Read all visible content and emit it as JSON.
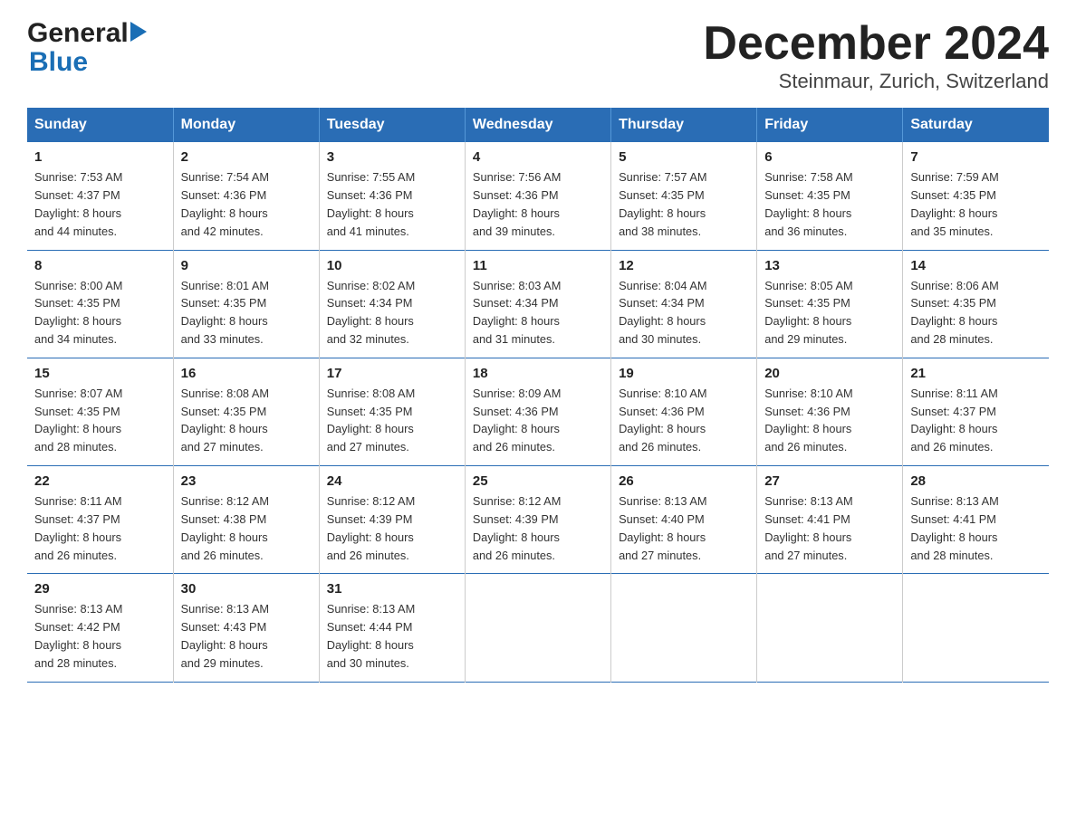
{
  "logo": {
    "general": "General",
    "blue": "Blue",
    "arrow": "▶"
  },
  "title": "December 2024",
  "subtitle": "Steinmaur, Zurich, Switzerland",
  "days_header": [
    "Sunday",
    "Monday",
    "Tuesday",
    "Wednesday",
    "Thursday",
    "Friday",
    "Saturday"
  ],
  "weeks": [
    [
      {
        "num": "1",
        "sunrise": "7:53 AM",
        "sunset": "4:37 PM",
        "daylight": "8 hours and 44 minutes."
      },
      {
        "num": "2",
        "sunrise": "7:54 AM",
        "sunset": "4:36 PM",
        "daylight": "8 hours and 42 minutes."
      },
      {
        "num": "3",
        "sunrise": "7:55 AM",
        "sunset": "4:36 PM",
        "daylight": "8 hours and 41 minutes."
      },
      {
        "num": "4",
        "sunrise": "7:56 AM",
        "sunset": "4:36 PM",
        "daylight": "8 hours and 39 minutes."
      },
      {
        "num": "5",
        "sunrise": "7:57 AM",
        "sunset": "4:35 PM",
        "daylight": "8 hours and 38 minutes."
      },
      {
        "num": "6",
        "sunrise": "7:58 AM",
        "sunset": "4:35 PM",
        "daylight": "8 hours and 36 minutes."
      },
      {
        "num": "7",
        "sunrise": "7:59 AM",
        "sunset": "4:35 PM",
        "daylight": "8 hours and 35 minutes."
      }
    ],
    [
      {
        "num": "8",
        "sunrise": "8:00 AM",
        "sunset": "4:35 PM",
        "daylight": "8 hours and 34 minutes."
      },
      {
        "num": "9",
        "sunrise": "8:01 AM",
        "sunset": "4:35 PM",
        "daylight": "8 hours and 33 minutes."
      },
      {
        "num": "10",
        "sunrise": "8:02 AM",
        "sunset": "4:34 PM",
        "daylight": "8 hours and 32 minutes."
      },
      {
        "num": "11",
        "sunrise": "8:03 AM",
        "sunset": "4:34 PM",
        "daylight": "8 hours and 31 minutes."
      },
      {
        "num": "12",
        "sunrise": "8:04 AM",
        "sunset": "4:34 PM",
        "daylight": "8 hours and 30 minutes."
      },
      {
        "num": "13",
        "sunrise": "8:05 AM",
        "sunset": "4:35 PM",
        "daylight": "8 hours and 29 minutes."
      },
      {
        "num": "14",
        "sunrise": "8:06 AM",
        "sunset": "4:35 PM",
        "daylight": "8 hours and 28 minutes."
      }
    ],
    [
      {
        "num": "15",
        "sunrise": "8:07 AM",
        "sunset": "4:35 PM",
        "daylight": "8 hours and 28 minutes."
      },
      {
        "num": "16",
        "sunrise": "8:08 AM",
        "sunset": "4:35 PM",
        "daylight": "8 hours and 27 minutes."
      },
      {
        "num": "17",
        "sunrise": "8:08 AM",
        "sunset": "4:35 PM",
        "daylight": "8 hours and 27 minutes."
      },
      {
        "num": "18",
        "sunrise": "8:09 AM",
        "sunset": "4:36 PM",
        "daylight": "8 hours and 26 minutes."
      },
      {
        "num": "19",
        "sunrise": "8:10 AM",
        "sunset": "4:36 PM",
        "daylight": "8 hours and 26 minutes."
      },
      {
        "num": "20",
        "sunrise": "8:10 AM",
        "sunset": "4:36 PM",
        "daylight": "8 hours and 26 minutes."
      },
      {
        "num": "21",
        "sunrise": "8:11 AM",
        "sunset": "4:37 PM",
        "daylight": "8 hours and 26 minutes."
      }
    ],
    [
      {
        "num": "22",
        "sunrise": "8:11 AM",
        "sunset": "4:37 PM",
        "daylight": "8 hours and 26 minutes."
      },
      {
        "num": "23",
        "sunrise": "8:12 AM",
        "sunset": "4:38 PM",
        "daylight": "8 hours and 26 minutes."
      },
      {
        "num": "24",
        "sunrise": "8:12 AM",
        "sunset": "4:39 PM",
        "daylight": "8 hours and 26 minutes."
      },
      {
        "num": "25",
        "sunrise": "8:12 AM",
        "sunset": "4:39 PM",
        "daylight": "8 hours and 26 minutes."
      },
      {
        "num": "26",
        "sunrise": "8:13 AM",
        "sunset": "4:40 PM",
        "daylight": "8 hours and 27 minutes."
      },
      {
        "num": "27",
        "sunrise": "8:13 AM",
        "sunset": "4:41 PM",
        "daylight": "8 hours and 27 minutes."
      },
      {
        "num": "28",
        "sunrise": "8:13 AM",
        "sunset": "4:41 PM",
        "daylight": "8 hours and 28 minutes."
      }
    ],
    [
      {
        "num": "29",
        "sunrise": "8:13 AM",
        "sunset": "4:42 PM",
        "daylight": "8 hours and 28 minutes."
      },
      {
        "num": "30",
        "sunrise": "8:13 AM",
        "sunset": "4:43 PM",
        "daylight": "8 hours and 29 minutes."
      },
      {
        "num": "31",
        "sunrise": "8:13 AM",
        "sunset": "4:44 PM",
        "daylight": "8 hours and 30 minutes."
      },
      null,
      null,
      null,
      null
    ]
  ],
  "labels": {
    "sunrise": "Sunrise: ",
    "sunset": "Sunset: ",
    "daylight": "Daylight: "
  }
}
